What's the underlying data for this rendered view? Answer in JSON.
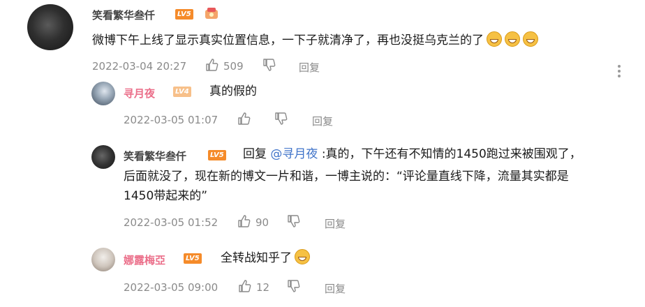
{
  "comments": [
    {
      "user": "笑看繁华叁仟",
      "level": "LV5",
      "text": "微博下午上线了显示真实位置信息，一下子就清净了，再也没挺乌克兰的了",
      "time": "2022-03-04 20:27",
      "likes": "509",
      "reply_label": "回复",
      "emoji_count": 3
    },
    {
      "user": "寻月夜",
      "level": "LV4",
      "text": "真的假的",
      "time": "2022-03-05 01:07",
      "likes": "",
      "reply_label": "回复"
    },
    {
      "user": "笑看繁华叁仟",
      "level": "LV5",
      "reply_prefix": "回复",
      "mention": "@寻月夜",
      "line1": ":真的，下午还有不知情的1450跑过来被围观了，",
      "line2": "后面就没了，现在新的博文一片和谐，一博主说的：“评论量直线下降，流量其实都是",
      "line3": "1450带起来的”",
      "time": "2022-03-05 01:52",
      "likes": "90",
      "reply_label": "回复"
    },
    {
      "user": "娜露梅亞",
      "level": "LV5",
      "text": "全转战知乎了",
      "time": "2022-03-05 09:00",
      "likes": "12",
      "reply_label": "回复"
    }
  ],
  "colors": {
    "lv5": "#f58b2a",
    "lv4": "#f7c08a",
    "pink_name": "#eb6f8a",
    "link": "#3f73c9",
    "meta": "#8a8a8a"
  }
}
